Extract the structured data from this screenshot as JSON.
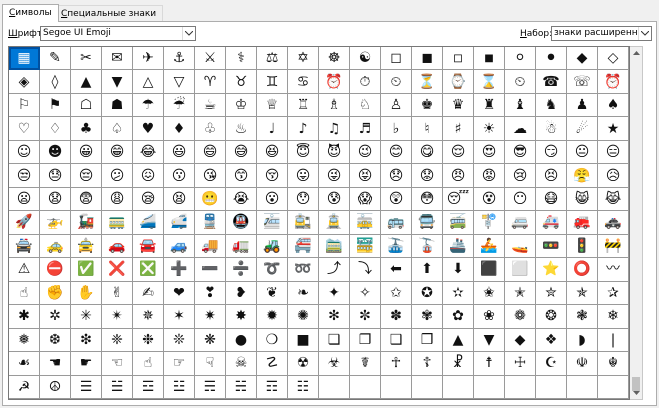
{
  "tabs": [
    {
      "label": "Символы",
      "accel": "С",
      "rest": "имволы"
    },
    {
      "label": "Специальные знаки",
      "accel": "С",
      "rest": "пециальные знаки"
    }
  ],
  "font": {
    "label_accel": "Ш",
    "label_rest": "рифт:",
    "value": "Segoe UI Emoji"
  },
  "subset": {
    "label_accel": "Н",
    "label_rest": "абор:",
    "value": "знаки расширенного"
  },
  "grid": {
    "selected_index": 0,
    "symbols": [
      "▦",
      "✎",
      "✂",
      "✉",
      "✈",
      "⚓",
      "⚔",
      "⚕",
      "⚖",
      "✡",
      "☸",
      "☯",
      "◻",
      "◼",
      "◽",
      "◾",
      "⚪",
      "⚫",
      "◆",
      "◇",
      "◈",
      "◊",
      "▲",
      "▼",
      "△",
      "▽",
      "♈",
      "♉",
      "♊",
      "♋",
      "⏰",
      "⏱",
      "⏲",
      "⏳",
      "⌚",
      "⌛",
      "⏲",
      "☎",
      "☏",
      "⏰",
      "⚐",
      "⚑",
      "☖",
      "☗",
      "☂",
      "☔",
      "☕",
      "♔",
      "♕",
      "♖",
      "♗",
      "♘",
      "♙",
      "♚",
      "♛",
      "♜",
      "♝",
      "♞",
      "♟",
      "♠",
      "♡",
      "♢",
      "♣",
      "♤",
      "♥",
      "♦",
      "♧",
      "♨",
      "♩",
      "♪",
      "♫",
      "♬",
      "♭",
      "♮",
      "♯",
      "☀",
      "☁",
      "☃",
      "☄",
      "★",
      "☺",
      "☻",
      "😀",
      "😁",
      "😂",
      "😃",
      "😄",
      "😅",
      "😆",
      "😇",
      "😈",
      "😉",
      "😊",
      "😋",
      "😌",
      "😍",
      "😎",
      "😏",
      "😐",
      "😑",
      "😒",
      "😓",
      "😔",
      "😕",
      "😖",
      "😗",
      "😘",
      "😙",
      "😚",
      "😛",
      "😜",
      "😝",
      "😞",
      "😟",
      "😠",
      "😡",
      "😢",
      "😣",
      "😤",
      "😥",
      "😦",
      "😧",
      "😨",
      "😩",
      "😪",
      "😫",
      "😬",
      "😭",
      "😮",
      "😯",
      "😰",
      "😱",
      "😲",
      "😳",
      "😴",
      "😵",
      "😶",
      "😷",
      "😸",
      "😹",
      "🚀",
      "🚁",
      "🚂",
      "🚃",
      "🚄",
      "🚅",
      "🚆",
      "🚇",
      "🚈",
      "🚉",
      "🚊",
      "🚋",
      "🚌",
      "🚍",
      "🚎",
      "🚏",
      "🚐",
      "🚑",
      "🚒",
      "🚓",
      "🚔",
      "🚕",
      "🚖",
      "🚗",
      "🚘",
      "🚙",
      "🚚",
      "🚛",
      "🚜",
      "🚝",
      "🚞",
      "🚟",
      "🚠",
      "🚡",
      "🚢",
      "🚣",
      "🚤",
      "🚥",
      "🚦",
      "🚧",
      "⚠",
      "⛔",
      "✅",
      "❌",
      "❎",
      "➕",
      "➖",
      "➗",
      "➰",
      "➿",
      "⤴",
      "⤵",
      "⬅",
      "⬆",
      "⬇",
      "⬛",
      "⬜",
      "⭐",
      "⭕",
      "〰",
      "☝",
      "✊",
      "✋",
      "✌",
      "✍",
      "❤",
      "❣",
      "❥",
      "❦",
      "❧",
      "✦",
      "✧",
      "✩",
      "✪",
      "✫",
      "✬",
      "✭",
      "✮",
      "✯",
      "✰",
      "✱",
      "✲",
      "✳",
      "✴",
      "✵",
      "✶",
      "✷",
      "✸",
      "✹",
      "✺",
      "✻",
      "✼",
      "✽",
      "✾",
      "✿",
      "❀",
      "❁",
      "❂",
      "❃",
      "❄",
      "❅",
      "❆",
      "❇",
      "❈",
      "❉",
      "❊",
      "❋",
      "●",
      "❍",
      "■",
      "❏",
      "❐",
      "❑",
      "❒",
      "▲",
      "▼",
      "◆",
      "❖",
      "◗",
      "❘",
      "☙",
      "☚",
      "☛",
      "☜",
      "☝",
      "☞",
      "☟",
      "☠",
      "☡",
      "☢",
      "☣",
      "☤",
      "☥",
      "☦",
      "☧",
      "☨",
      "☩",
      "☪",
      "☫",
      "☬",
      "☭",
      "☮",
      "☰",
      "☱",
      "☲",
      "☳",
      "☴",
      "☵",
      "☶",
      "☷",
      "",
      "",
      "",
      "",
      "",
      "",
      "",
      "",
      "",
      ""
    ]
  }
}
